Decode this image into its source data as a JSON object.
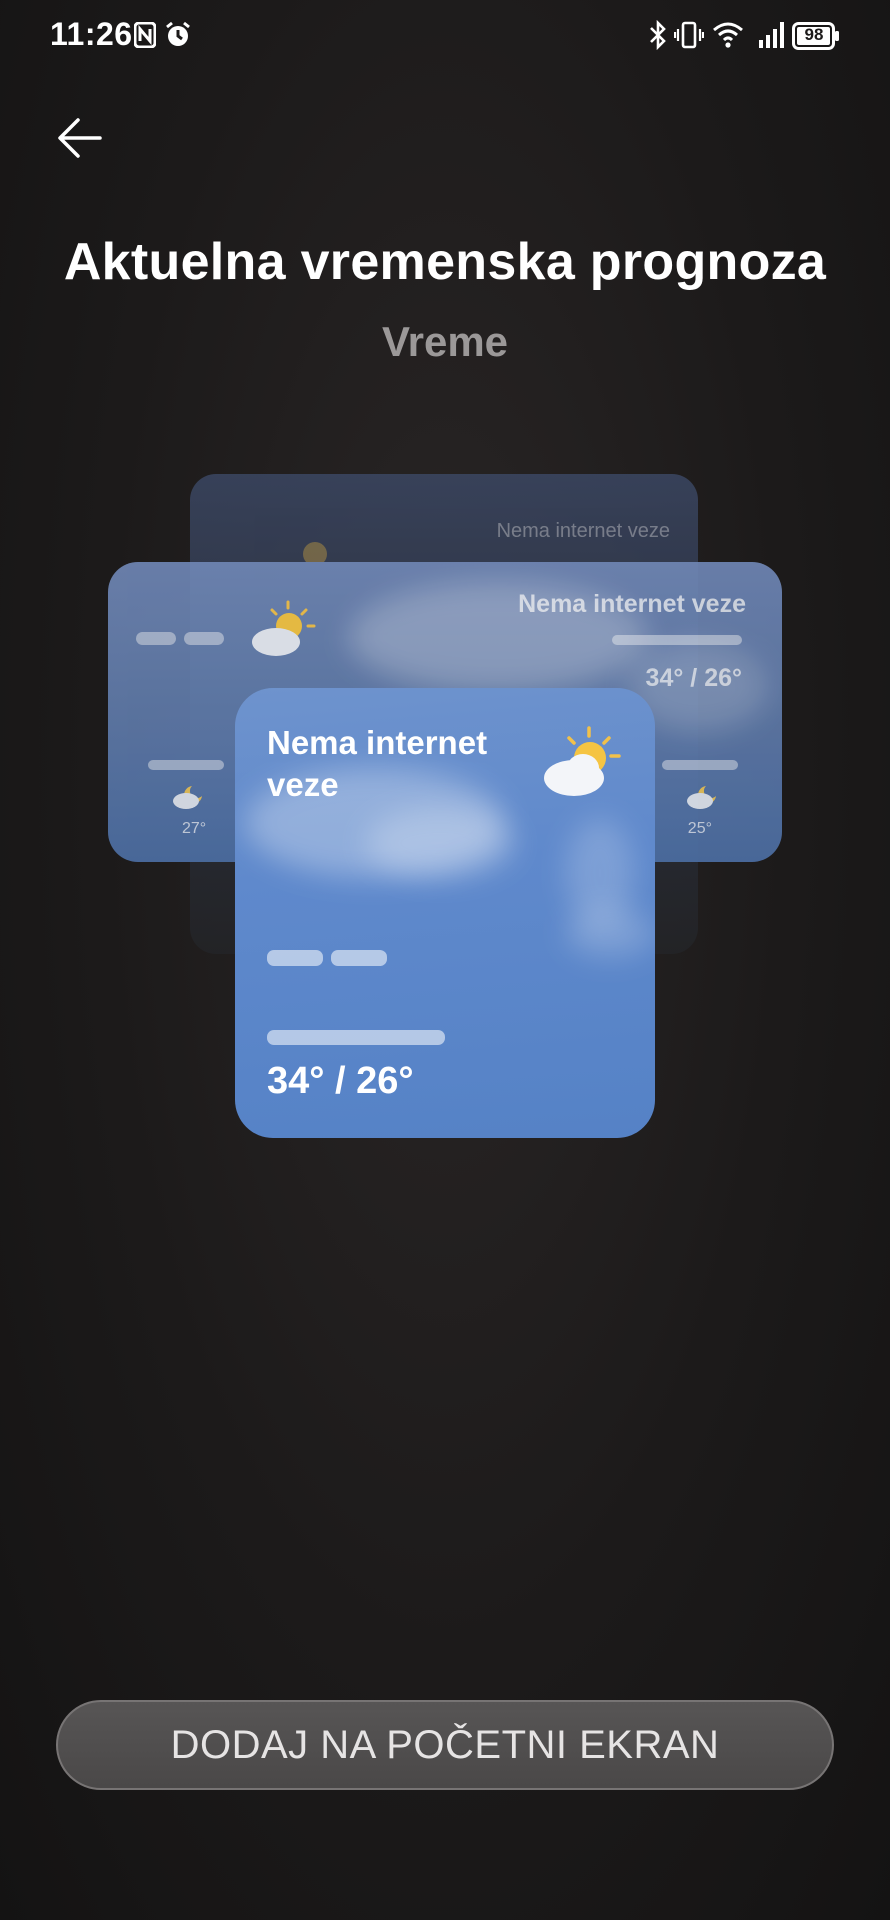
{
  "status_bar": {
    "time": "11:26",
    "battery_level": "98",
    "icons": [
      "nfc-icon",
      "alarm-icon",
      "bluetooth-icon",
      "vibrate-icon",
      "wifi-icon",
      "signal-icon",
      "battery-icon"
    ]
  },
  "header": {
    "back_icon": "back-arrow-icon",
    "title": "Aktuelna vremenska prognoza",
    "subtitle": "Vreme"
  },
  "preview": {
    "back_card": {
      "status": "Nema internet veze"
    },
    "middle_card": {
      "status": "Nema internet veze",
      "temp_range": "34° / 26°",
      "left_temp": "27°",
      "right_temp": "25°"
    },
    "front_card": {
      "status": "Nema internet veze",
      "temp_range": "34° / 26°",
      "weather_icon": "partly-sunny-icon"
    }
  },
  "actions": {
    "add_to_home": "DODAJ NA POČETNI EKRAN"
  },
  "colors": {
    "background": "#1c1a1a",
    "card_sky": "#5f89cc",
    "button_bg": "#4f4d4d",
    "sun": "#f4c542"
  }
}
